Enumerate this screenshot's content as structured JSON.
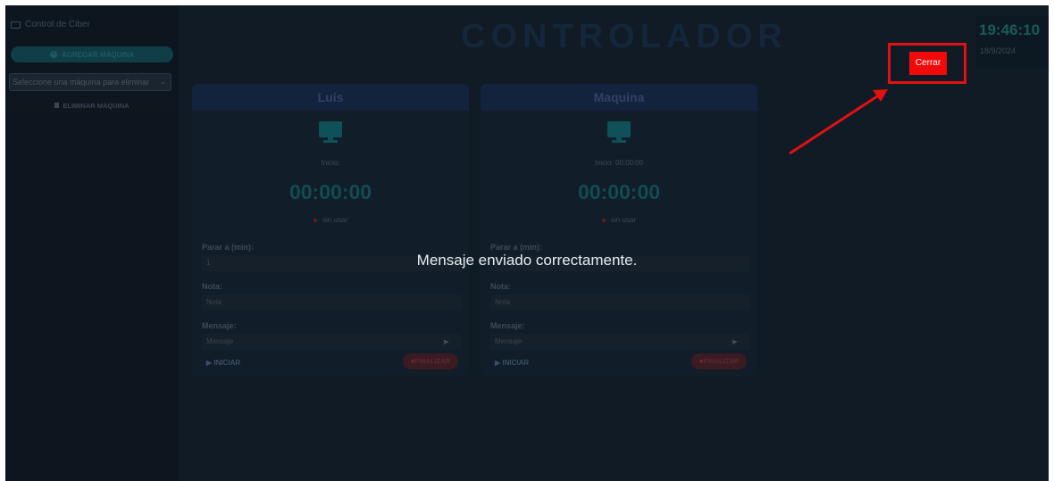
{
  "sidebar": {
    "brand": "Control de Ciber",
    "add_machine_label": "AGREGAR MAQUINA",
    "select_placeholder": "Seleccione una máquina para eliminar",
    "delete_machine_label": "ELIMINAR MÁQUINA"
  },
  "header": {
    "title": "CONTROLADOR"
  },
  "clock": {
    "time": "19:46:10",
    "date": "18/9/2024"
  },
  "close_button": {
    "label": "Cerrar"
  },
  "toast": {
    "message": "Mensaje enviado correctamente."
  },
  "machines": [
    {
      "name": "Luis",
      "start_label": "Inicio:",
      "timer": "00:00:00",
      "status": "sin usar",
      "stop_label": "Parar a (min):",
      "stop_value": "1",
      "note_label": "Nota:",
      "note_placeholder": "Nota",
      "message_label": "Mensaje:",
      "message_placeholder": "Mensaje",
      "start_button": "INICIAR",
      "finish_button": "FINALIZAR"
    },
    {
      "name": "Maquina",
      "start_label": "Inicio: 00:00:00",
      "timer": "00:00:00",
      "status": "sin usar",
      "stop_label": "Parar a (min):",
      "stop_value": "",
      "note_label": "Nota:",
      "note_placeholder": "Nota",
      "message_label": "Mensaje:",
      "message_placeholder": "Mensaje",
      "start_button": "INICIAR",
      "finish_button": "FINALIZAR"
    }
  ],
  "colors": {
    "background": "#101b26",
    "accent": "#114c53",
    "highlight": "#e11111",
    "close_button": "#f00a0a"
  },
  "icons": {
    "brand": "monitor-icon",
    "add": "plus-circle-icon",
    "delete": "trash-icon",
    "machine": "desktop-icon",
    "send": "send-icon",
    "play": "play-icon",
    "stop": "stop-icon"
  }
}
